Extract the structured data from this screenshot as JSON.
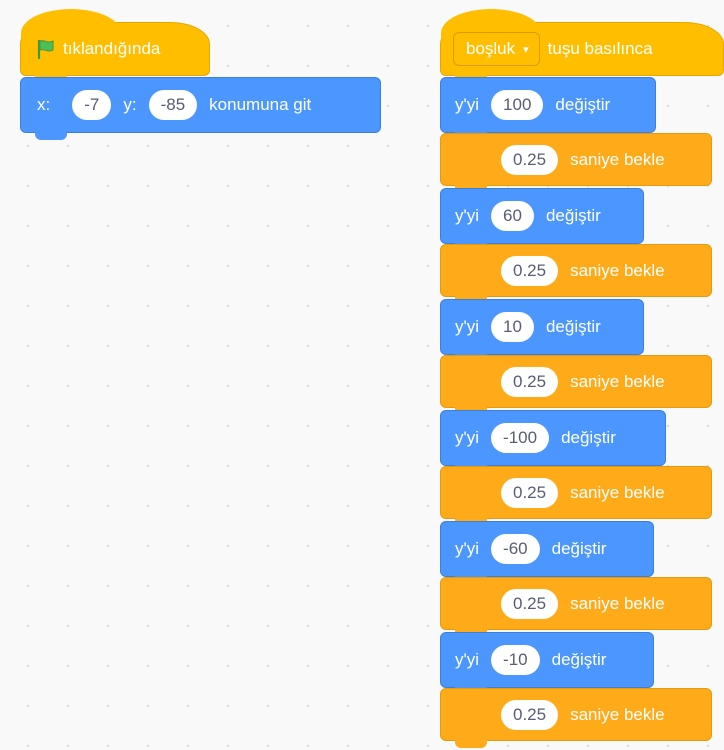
{
  "left_script": {
    "hat": {
      "label": "tıklandığında",
      "icon": "green-flag-icon"
    },
    "goto": {
      "x_label": "x:",
      "x_value": "-7",
      "y_label": "y:",
      "y_value": "-85",
      "label": "konumuna git"
    }
  },
  "right_script": {
    "hat": {
      "key_value": "boşluk",
      "caret": "▾",
      "label": "tuşu basılınca"
    },
    "steps": [
      {
        "prefix": "y'yi",
        "value": "100",
        "label": "değiştir",
        "wait_value": "0.25",
        "wait_label": "saniye bekle"
      },
      {
        "prefix": "y'yi",
        "value": "60",
        "label": "değiştir",
        "wait_value": "0.25",
        "wait_label": "saniye bekle"
      },
      {
        "prefix": "y'yi",
        "value": "10",
        "label": "değiştir",
        "wait_value": "0.25",
        "wait_label": "saniye bekle"
      },
      {
        "prefix": "y'yi",
        "value": "-100",
        "label": "değiştir",
        "wait_value": "0.25",
        "wait_label": "saniye bekle"
      },
      {
        "prefix": "y'yi",
        "value": "-60",
        "label": "değiştir",
        "wait_value": "0.25",
        "wait_label": "saniye bekle"
      },
      {
        "prefix": "y'yi",
        "value": "-10",
        "label": "değiştir",
        "wait_value": "0.25",
        "wait_label": "saniye bekle"
      }
    ]
  },
  "colors": {
    "events": "#ffbf00",
    "motion": "#4c97ff",
    "control": "#ffab19",
    "flag": "#4cbf56"
  }
}
